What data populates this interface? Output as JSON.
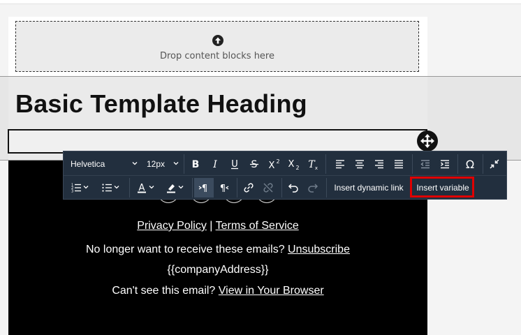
{
  "dropzone": {
    "label": "Drop content blocks here",
    "icon": "upload-arrow-icon"
  },
  "heading": {
    "text": "Basic Template Heading"
  },
  "toolbar": {
    "font_family": "Helvetica",
    "font_size": "12px",
    "insert_dynamic_link": "Insert dynamic link",
    "insert_variable": "Insert variable",
    "icons": [
      "bold-icon",
      "italic-icon",
      "underline-icon",
      "strikethrough-icon",
      "superscript-icon",
      "subscript-icon",
      "clear-format-icon",
      "align-left-icon",
      "align-center-icon",
      "align-right-icon",
      "justify-icon",
      "outdent-icon",
      "indent-icon",
      "special-char-icon",
      "collapse-icon",
      "numbered-list-icon",
      "bullet-list-icon",
      "text-color-icon",
      "highlight-icon",
      "ltr-icon",
      "rtl-icon",
      "link-icon",
      "unlink-icon",
      "undo-icon",
      "redo-icon"
    ]
  },
  "footer": {
    "privacy": "Privacy Policy",
    "pipe": "|",
    "terms": "Terms of Service",
    "unsub_prefix": "No longer want to receive these emails?",
    "unsub_link": "Unsubscribe",
    "address": "{{companyAddress}}",
    "browser_prefix": "Can't see this email?",
    "browser_link": "View in Your Browser"
  },
  "colors": {
    "toolbar_bg": "#222f3e",
    "highlight": "#e00000",
    "footer_bg": "#000000"
  }
}
